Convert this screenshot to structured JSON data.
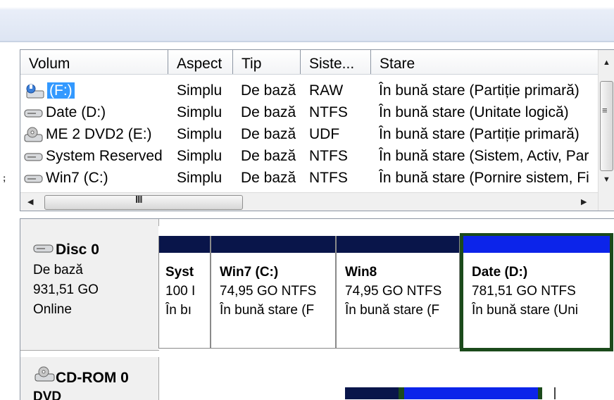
{
  "columns": [
    "Volum",
    "Aspect",
    "Tip",
    "Siste...",
    "Stare"
  ],
  "volumes": [
    {
      "name": "(F:)",
      "aspect": "Simplu",
      "tip": "De bază",
      "sistem": "RAW",
      "stare": "În bună stare (Partiție primară)"
    },
    {
      "name": "Date (D:)",
      "aspect": "Simplu",
      "tip": "De bază",
      "sistem": "NTFS",
      "stare": "În bună stare (Unitate logică)"
    },
    {
      "name": "ME 2 DVD2 (E:)",
      "aspect": "Simplu",
      "tip": "De bază",
      "sistem": "UDF",
      "stare": "În bună stare (Partiție primară)"
    },
    {
      "name": "System Reserved",
      "aspect": "Simplu",
      "tip": "De bază",
      "sistem": "NTFS",
      "stare": "În bună stare (Sistem, Activ, Par"
    },
    {
      "name": "Win7 (C:)",
      "aspect": "Simplu",
      "tip": "De bază",
      "sistem": "NTFS",
      "stare": "În bună stare (Pornire sistem, Fi"
    }
  ],
  "scroll": {
    "hgrip": "III",
    "vgrip": "≡"
  },
  "disk0": {
    "title": "Disc 0",
    "type": "De bază",
    "size": "931,51 GO",
    "status": "Online"
  },
  "partitions": [
    {
      "title": "Syst",
      "size": "100 I",
      "status": "În bı"
    },
    {
      "title": "Win7  (C:)",
      "size": "74,95 GO NTFS",
      "status": "În bună stare (F"
    },
    {
      "title": "Win8",
      "size": "74,95 GO NTFS",
      "status": "În bună stare (F"
    },
    {
      "title": "Date  (D:)",
      "size": "781,51 GO NTFS",
      "status": "În bună stare (Uni"
    }
  ],
  "cdrom": {
    "title": "CD-ROM 0",
    "type": "DVD"
  },
  "left_marker": ";",
  "colors": {
    "selection": "#3399ff",
    "partition_primary": "#09154a",
    "partition_logical": "#0c24ea",
    "selected_border": "#1b4a1b"
  }
}
